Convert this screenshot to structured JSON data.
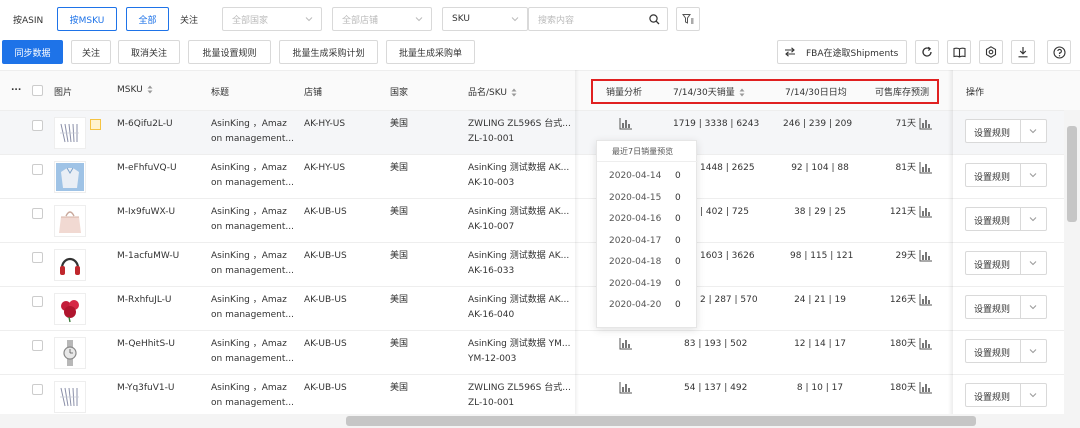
{
  "filters": {
    "by_asin": "按ASIN",
    "by_msku": "按MSKU",
    "all": "全部",
    "follow": "关注",
    "country_placeholder": "全部国家",
    "store_placeholder": "全部店铺",
    "sku_select": "SKU",
    "search_placeholder": "搜索内容"
  },
  "toolbar": {
    "sync": "同步数据",
    "follow": "关注",
    "unfollow": "取消关注",
    "batch_rules": "批量设置规则",
    "batch_plan": "批量生成采购计划",
    "batch_order": "批量生成采购单",
    "fba_shipments": "FBA在途取Shipments"
  },
  "columns": {
    "more": "...",
    "image": "图片",
    "msku": "MSKU",
    "title": "标题",
    "store": "店铺",
    "country": "国家",
    "product_sku": "品名/SKU",
    "sales_analysis": "销量分析",
    "sales_7_14_30": "7/14/30天销量",
    "daily_avg": "7/14/30日日均",
    "stock_forecast": "可售库存预测",
    "actions": "操作"
  },
  "rows": [
    {
      "msku": "M-6Qifu2L-U",
      "title1": "AsinKing ，Amaz",
      "title2": "on management...",
      "store": "AK-HY-US",
      "country": "美国",
      "name1": "ZWLING ZL596S 台式...",
      "name2": "ZL-10-001",
      "sales": "1719 | 3338 | 6243",
      "avg": "246 | 239 | 209",
      "forecast": "71天",
      "action": "设置规则",
      "thumb": "pens"
    },
    {
      "msku": "M-eFhfuVQ-U",
      "title1": "AsinKing ，Amaz",
      "title2": "on management...",
      "store": "AK-HY-US",
      "country": "美国",
      "name1": "AsinKing 测试数据 AK...",
      "name2": "AK-10-003",
      "sales": "1448 | 2625",
      "avg": "92 | 104 | 88",
      "forecast": "81天",
      "action": "设置规则",
      "thumb": "shirt"
    },
    {
      "msku": "M-Ix9fuWX-U",
      "title1": "AsinKing ，Amaz",
      "title2": "on management...",
      "store": "AK-UB-US",
      "country": "美国",
      "name1": "AsinKing 测试数据 AK...",
      "name2": "AK-10-007",
      "sales": "| 402 | 725",
      "avg": "38 | 29 | 25",
      "forecast": "121天",
      "action": "设置规则",
      "thumb": "bag"
    },
    {
      "msku": "M-1acfuMW-U",
      "title1": "AsinKing ，Amaz",
      "title2": "on management...",
      "store": "AK-UB-US",
      "country": "美国",
      "name1": "AsinKing 测试数据 AK...",
      "name2": "AK-16-033",
      "sales": "1603 | 3626",
      "avg": "98 | 115 | 121",
      "forecast": "29天",
      "action": "设置规则",
      "thumb": "headphones"
    },
    {
      "msku": "M-RxhfuJL-U",
      "title1": "AsinKing ，Amaz",
      "title2": "on management...",
      "store": "AK-UB-US",
      "country": "美国",
      "name1": "AsinKing 测试数据 AK...",
      "name2": "AK-16-040",
      "sales": "2 | 287 | 570",
      "avg": "24 | 21 | 19",
      "forecast": "126天",
      "action": "设置规则",
      "thumb": "flowers"
    },
    {
      "msku": "M-QeHhitS-U",
      "title1": "AsinKing ，Amaz",
      "title2": "on management...",
      "store": "AK-UB-US",
      "country": "美国",
      "name1": "AsinKing 测试数据 YM...",
      "name2": "YM-12-003",
      "sales": "83 | 193 | 502",
      "avg": "12 | 14 | 17",
      "forecast": "180天",
      "action": "设置规则",
      "thumb": "watch"
    },
    {
      "msku": "M-Yq3fuV1-U",
      "title1": "AsinKing ，Amaz",
      "title2": "on management...",
      "store": "AK-UB-US",
      "country": "美国",
      "name1": "ZWLING ZL596S 台式...",
      "name2": "ZL-10-001",
      "sales": "54 | 137 | 492",
      "avg": "8 | 10 | 17",
      "forecast": "180天",
      "action": "设置规则",
      "thumb": "pens"
    }
  ],
  "popover": {
    "title": "最近7日销量预览",
    "items": [
      {
        "date": "2020-04-14",
        "value": "0"
      },
      {
        "date": "2020-04-15",
        "value": "0"
      },
      {
        "date": "2020-04-16",
        "value": "0"
      },
      {
        "date": "2020-04-17",
        "value": "0"
      },
      {
        "date": "2020-04-18",
        "value": "0"
      },
      {
        "date": "2020-04-19",
        "value": "0"
      },
      {
        "date": "2020-04-20",
        "value": "0"
      }
    ]
  },
  "colors": {
    "primary": "#1e73e8",
    "highlight_box": "#e02020",
    "chart_icon": "#555555"
  }
}
